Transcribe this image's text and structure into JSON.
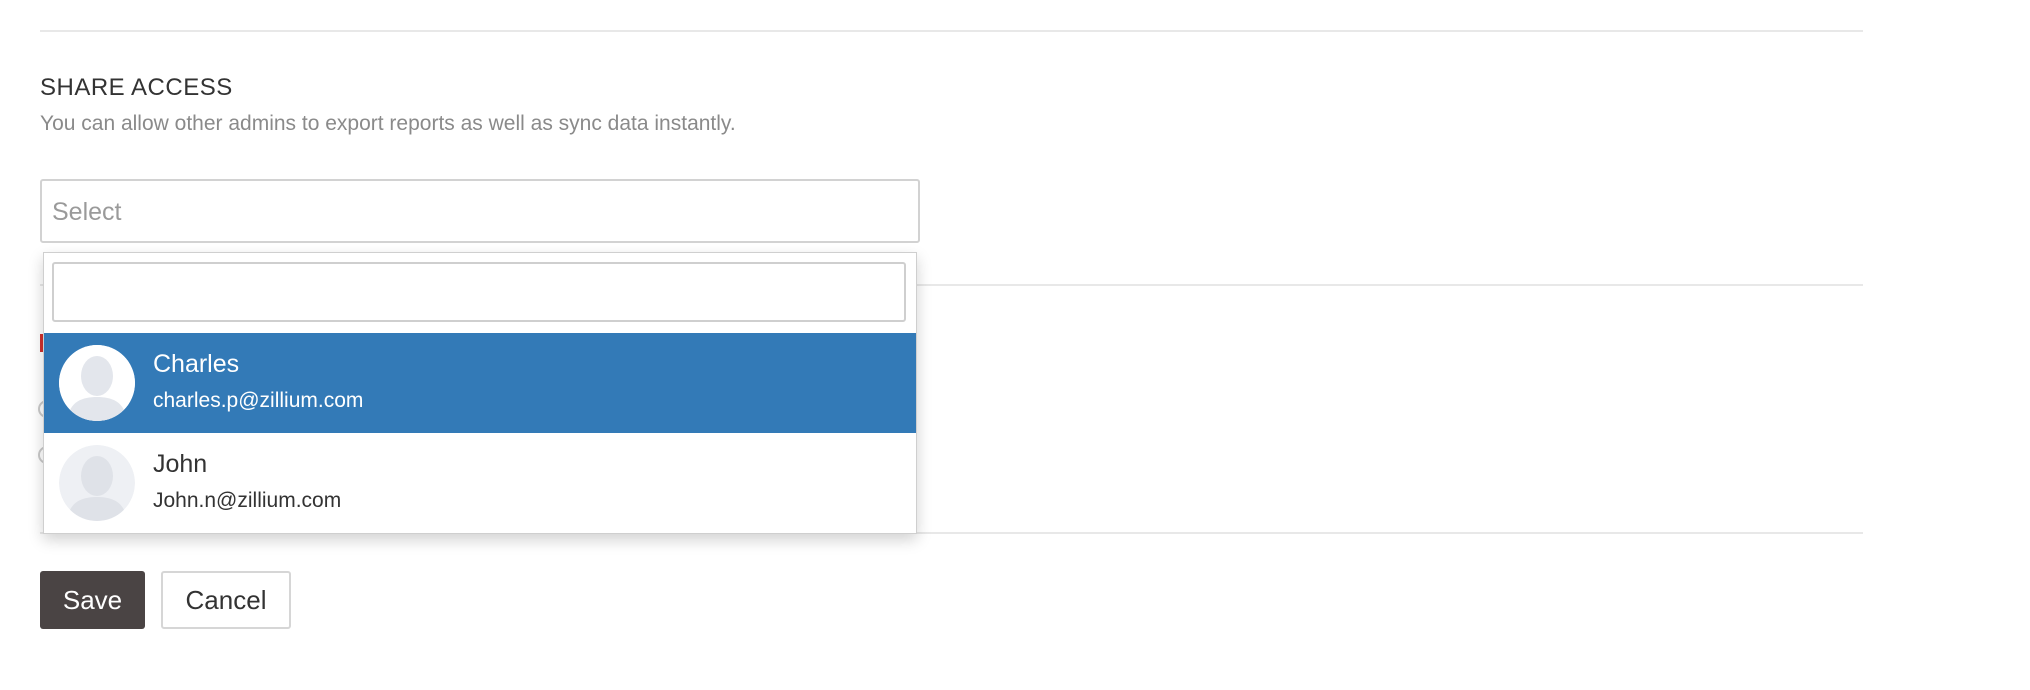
{
  "share_access": {
    "title": "SHARE ACCESS",
    "description": "You can allow other admins to export reports as well as sync data instantly.",
    "select_placeholder": "Select",
    "dropdown": {
      "search_value": "",
      "options": [
        {
          "name": "Charles",
          "email": "charles.p@zillium.com",
          "highlighted": true,
          "avatar_icon": "user-silhouette-icon"
        },
        {
          "name": "John",
          "email": "John.n@zillium.com",
          "highlighted": false,
          "avatar_icon": "user-silhouette-icon"
        }
      ]
    }
  },
  "actions": {
    "save_label": "Save",
    "cancel_label": "Cancel"
  },
  "colors": {
    "highlight": "#337ab7",
    "save_button": "#4a4444",
    "description_text": "#8a8a8a"
  }
}
